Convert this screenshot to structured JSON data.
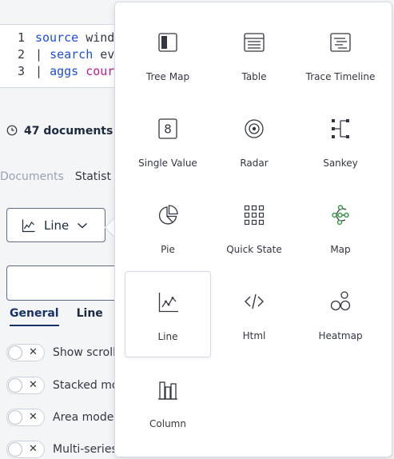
{
  "query": {
    "lines": [
      {
        "num": "1",
        "parts": [
          {
            "text": "source",
            "color": "blue"
          },
          {
            "text": " wind",
            "color": "default"
          }
        ]
      },
      {
        "num": "2",
        "parts": [
          {
            "text": "| ",
            "color": "default"
          },
          {
            "text": "search",
            "color": "blue"
          },
          {
            "text": " ev",
            "color": "default"
          }
        ]
      },
      {
        "num": "3",
        "parts": [
          {
            "text": "| ",
            "color": "default"
          },
          {
            "text": "aggs",
            "color": "blue"
          },
          {
            "text": " cour",
            "color": "pink"
          }
        ]
      }
    ]
  },
  "summary": {
    "text": "47 documents m"
  },
  "result_tabs": {
    "documents": "Documents",
    "statistics": "Statist"
  },
  "viz_select": {
    "label": "Line",
    "icon": "line-chart-icon"
  },
  "option_tabs": {
    "general": "General",
    "line": "Line"
  },
  "options": [
    {
      "label": "Show scroll",
      "checked": false
    },
    {
      "label": "Stacked mod",
      "checked": false
    },
    {
      "label": "Area mode",
      "checked": false
    },
    {
      "label": "Multi-series",
      "checked": false
    }
  ],
  "visualizations": [
    {
      "label": "Tree Map",
      "icon": "tree-map-icon"
    },
    {
      "label": "Table",
      "icon": "table-icon"
    },
    {
      "label": "Trace Timeline",
      "icon": "trace-timeline-icon"
    },
    {
      "label": "Single Value",
      "icon": "single-value-icon"
    },
    {
      "label": "Radar",
      "icon": "radar-icon"
    },
    {
      "label": "Sankey",
      "icon": "sankey-icon"
    },
    {
      "label": "Pie",
      "icon": "pie-icon"
    },
    {
      "label": "Quick State",
      "icon": "quick-state-icon"
    },
    {
      "label": "Map",
      "icon": "map-icon"
    },
    {
      "label": "Line",
      "icon": "line-chart-icon",
      "selected": true
    },
    {
      "label": "Html",
      "icon": "code-icon"
    },
    {
      "label": "Heatmap",
      "icon": "heatmap-icon"
    },
    {
      "label": "Column",
      "icon": "column-icon"
    }
  ],
  "colors": {
    "accent": "#17316a",
    "border": "#d3dae6",
    "keyword_blue": "#1a4fd6",
    "keyword_pink": "#c5198d",
    "map_green": "#3e9a4a"
  }
}
